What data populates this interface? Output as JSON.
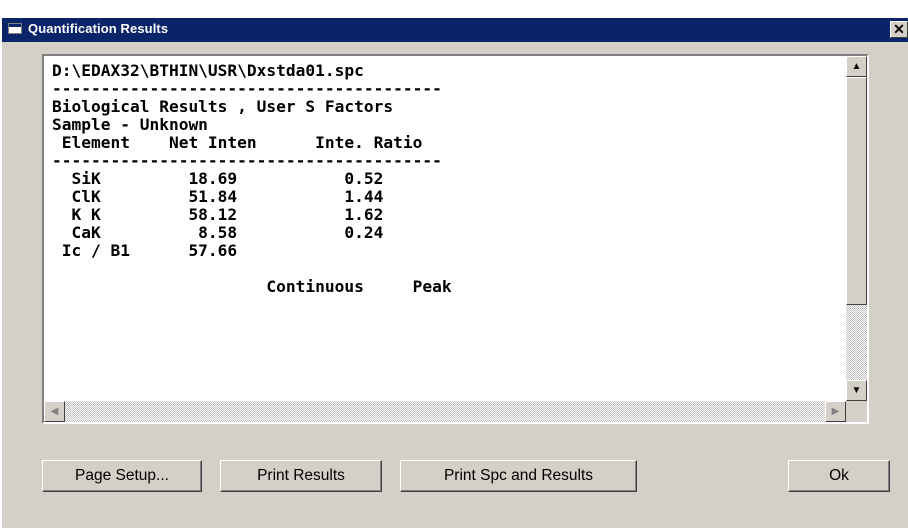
{
  "window": {
    "title": "Quantification Results",
    "close_glyph": "✕"
  },
  "results": {
    "lines": [
      "D:\\EDAX32\\BTHIN\\USR\\Dxstda01.spc",
      "----------------------------------------",
      "Biological Results , User S Factors",
      "Sample - Unknown",
      " Element    Net Inten      Inte. Ratio",
      "----------------------------------------",
      "  SiK         18.69           0.52",
      "  ClK         51.84           1.44",
      "  K K         58.12           1.62",
      "  CaK          8.58           0.24",
      " Ic / B1      57.66",
      "",
      "                      Continuous     Peak"
    ]
  },
  "scrollbar": {
    "up": "▲",
    "down": "▼",
    "left": "◀",
    "right": "▶"
  },
  "buttons": {
    "page_setup": "Page Setup...",
    "print_results": "Print Results",
    "print_spc_results": "Print Spc and Results",
    "ok": "Ok"
  }
}
